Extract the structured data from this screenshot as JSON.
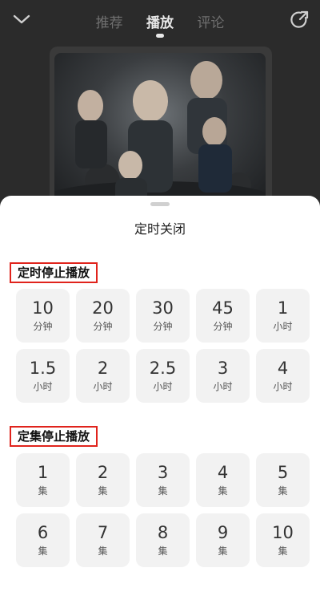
{
  "header": {
    "tabs": [
      {
        "label": "推荐",
        "active": false
      },
      {
        "label": "播放",
        "active": true
      },
      {
        "label": "评论",
        "active": false
      }
    ],
    "icons": [
      "chevron-down-icon",
      "share-icon"
    ]
  },
  "sheet": {
    "title": "定时关闭",
    "section_time": {
      "label": "定时停止播放",
      "options": [
        {
          "num": "10",
          "unit": "分钟"
        },
        {
          "num": "20",
          "unit": "分钟"
        },
        {
          "num": "30",
          "unit": "分钟"
        },
        {
          "num": "45",
          "unit": "分钟"
        },
        {
          "num": "1",
          "unit": "小时"
        },
        {
          "num": "1.5",
          "unit": "小时"
        },
        {
          "num": "2",
          "unit": "小时"
        },
        {
          "num": "2.5",
          "unit": "小时"
        },
        {
          "num": "3",
          "unit": "小时"
        },
        {
          "num": "4",
          "unit": "小时"
        }
      ]
    },
    "section_episode": {
      "label": "定集停止播放",
      "options": [
        {
          "num": "1",
          "unit": "集"
        },
        {
          "num": "2",
          "unit": "集"
        },
        {
          "num": "3",
          "unit": "集"
        },
        {
          "num": "4",
          "unit": "集"
        },
        {
          "num": "5",
          "unit": "集"
        },
        {
          "num": "6",
          "unit": "集"
        },
        {
          "num": "7",
          "unit": "集"
        },
        {
          "num": "8",
          "unit": "集"
        },
        {
          "num": "9",
          "unit": "集"
        },
        {
          "num": "10",
          "unit": "集"
        }
      ]
    }
  },
  "colors": {
    "highlight_border": "#e0231c",
    "cell_bg": "#f2f2f2",
    "top_bg": "#2b2b2b"
  }
}
